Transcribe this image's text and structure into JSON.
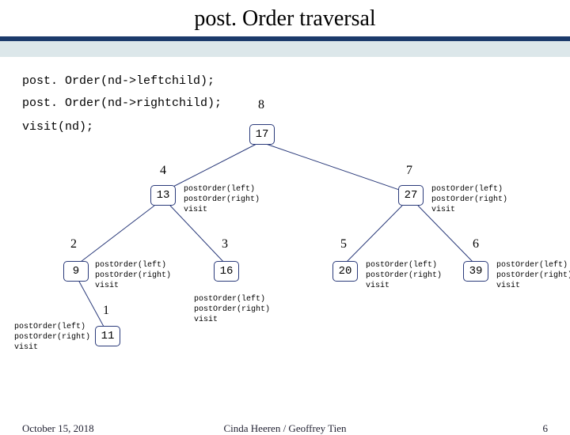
{
  "title": "post. Order traversal",
  "code": {
    "l1": "post. Order(nd->leftchild);",
    "l2": "post. Order(nd->rightchild);",
    "l3": "visit(nd);"
  },
  "order": {
    "o8": "8",
    "o4": "4",
    "o7": "7",
    "o2": "2",
    "o3": "3",
    "o5": "5",
    "o6": "6",
    "o1": "1"
  },
  "nodes": {
    "n17": "17",
    "n13": "13",
    "n27": "27",
    "n9": "9",
    "n16": "16",
    "n20": "20",
    "n39": "39",
    "n11": "11"
  },
  "callblock": "postOrder(left)\npostOrder(right)\nvisit",
  "footer": {
    "date": "October 15, 2018",
    "author": "Cinda Heeren / Geoffrey Tien",
    "page": "6"
  }
}
